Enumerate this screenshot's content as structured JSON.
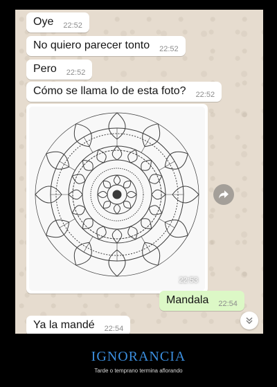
{
  "messages": [
    {
      "text": "Oye",
      "time": "22:52",
      "direction": "incoming"
    },
    {
      "text": "No quiero parecer tonto",
      "time": "22:52",
      "direction": "incoming"
    },
    {
      "text": "Pero",
      "time": "22:52",
      "direction": "incoming"
    },
    {
      "text": "Cómo se llama lo de esta foto?",
      "time": "22:52",
      "direction": "incoming"
    },
    {
      "text": "Mandala",
      "time": "22:54",
      "direction": "outgoing"
    },
    {
      "text": "Ya la mandé",
      "time": "22:54",
      "direction": "incoming"
    }
  ],
  "image_message": {
    "time": "22:53",
    "icon": "mandala-image",
    "action_icon": "forward-icon"
  },
  "scroll_button": {
    "icon": "chevron-double-down-icon"
  },
  "colors": {
    "incoming_bubble": "#ffffff",
    "outgoing_bubble": "#dcf8c6",
    "chat_background": "#e6dccf",
    "title_color": "#3b8ede"
  },
  "footer": {
    "title": "IGNORANCIA",
    "subtitle": "Tarde o temprano termina aflorando"
  }
}
